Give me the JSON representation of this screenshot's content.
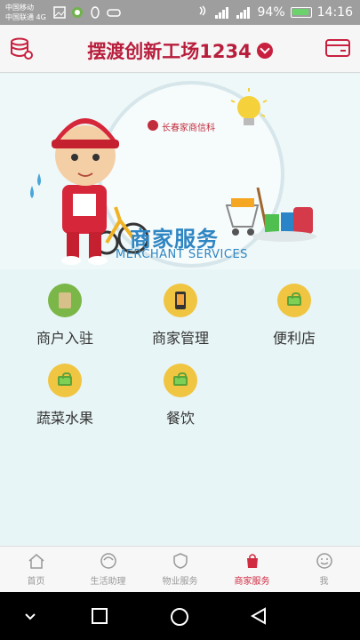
{
  "status_bar": {
    "carrier_line1": "中国移动",
    "carrier_line2": "中国联通 4G",
    "network_1": "G",
    "network_2": "4G",
    "battery": "94%",
    "time": "14:16"
  },
  "header": {
    "title": "摆渡创新工场1234",
    "left_icon": "database-icon",
    "right_icon": "card-icon"
  },
  "banner": {
    "brand": "长春家商信科",
    "title": "商家服务",
    "subtitle": "MERCHANT SERVICES"
  },
  "grid": {
    "items": [
      {
        "label": "商户入驻",
        "icon": "merchant-join-icon",
        "color": "#7ab648"
      },
      {
        "label": "商家管理",
        "icon": "merchant-manage-icon",
        "color": "#f0c542"
      },
      {
        "label": "便利店",
        "icon": "basket-icon",
        "color": "#f0c542"
      },
      {
        "label": "蔬菜水果",
        "icon": "basket-icon",
        "color": "#f0c542"
      },
      {
        "label": "餐饮",
        "icon": "basket-icon",
        "color": "#f0c542"
      }
    ]
  },
  "tabs": [
    {
      "label": "首页",
      "icon": "home-icon",
      "active": false
    },
    {
      "label": "生活助理",
      "icon": "assistant-icon",
      "active": false
    },
    {
      "label": "物业服务",
      "icon": "shield-icon",
      "active": false
    },
    {
      "label": "商家服务",
      "icon": "shop-bag-icon",
      "active": true
    },
    {
      "label": "我",
      "icon": "smile-icon",
      "active": false
    }
  ],
  "colors": {
    "brand_red": "#b81e3c",
    "banner_blue": "#2f86c2",
    "tab_active": "#d02b41"
  }
}
